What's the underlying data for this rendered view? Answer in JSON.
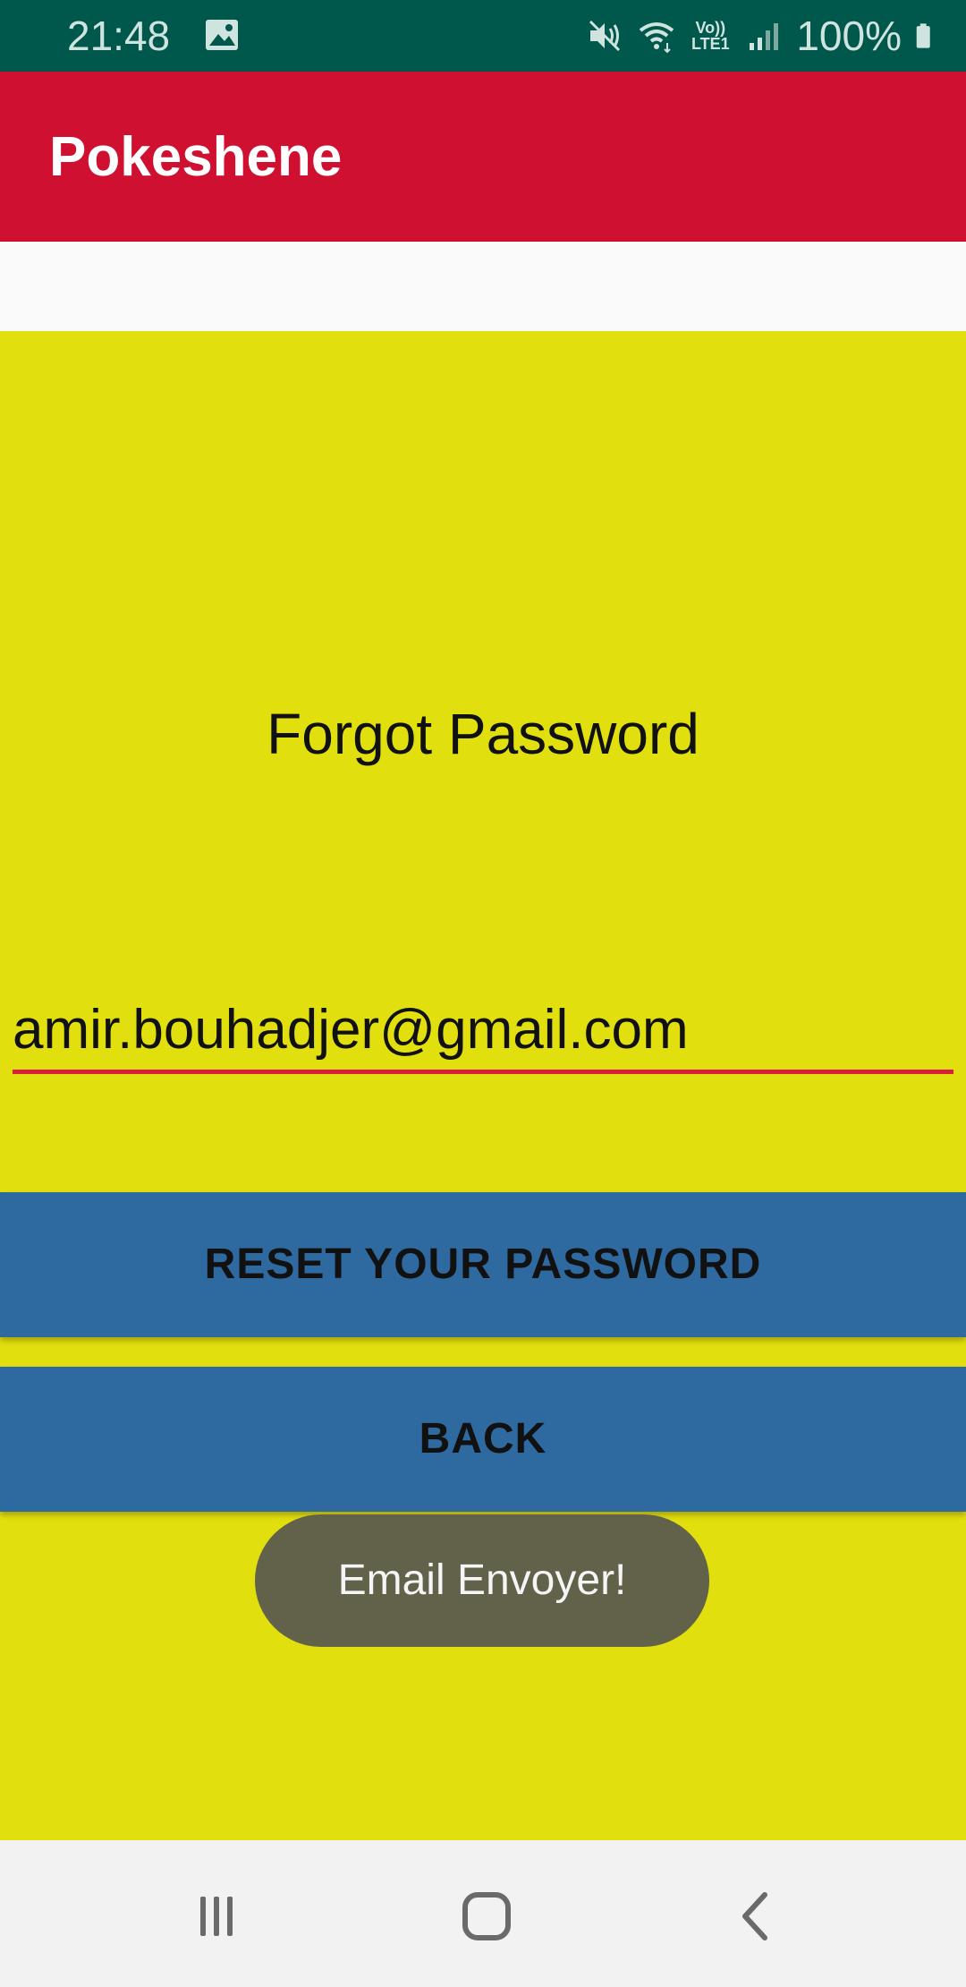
{
  "status_bar": {
    "time": "21:48",
    "gallery_icon": "image-icon",
    "mute_icon": "vibrate-mute-icon",
    "wifi_icon": "wifi-icon",
    "lte_line1": "Vo))",
    "lte_line2": "LTE1",
    "signal_icon": "signal-icon",
    "battery_percent": "100%",
    "battery_icon": "battery-icon",
    "background_color": "#00574b"
  },
  "app_bar": {
    "title": "Pokeshene",
    "background_color": "#d01030"
  },
  "main": {
    "heading": "Forgot Password",
    "email_value": "amir.bouhadjer@gmail.com",
    "reset_button_label": "RESET YOUR PASSWORD",
    "back_button_label": "BACK",
    "background_color": "#e2df0e",
    "button_color": "#2e69a0"
  },
  "toast": {
    "message": "Email Envoyer!"
  },
  "nav_bar": {
    "recents_icon": "recents-icon",
    "home_icon": "home-icon",
    "back_icon": "back-icon"
  }
}
